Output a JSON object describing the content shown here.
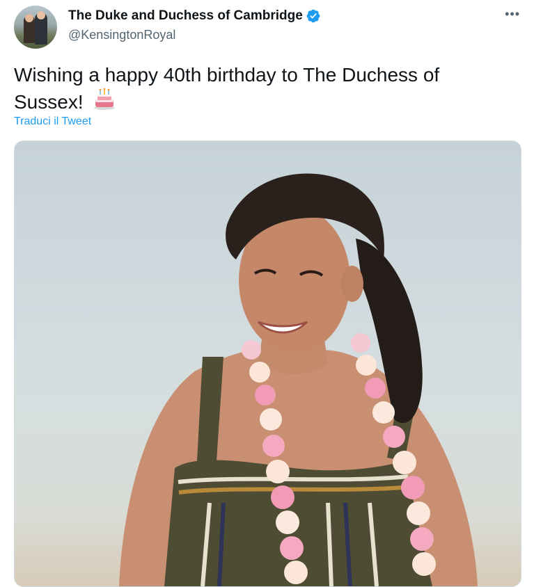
{
  "author": {
    "display_name": "The Duke and Duchess of Cambridge",
    "handle": "@KensingtonRoyal",
    "verified": true,
    "avatar_icon": "profile-photo"
  },
  "tweet": {
    "text": "Wishing a happy 40th birthday to The Duchess of Sussex!",
    "emoji": "birthday-cake",
    "translate_label": "Traduci il Tweet"
  },
  "menu": {
    "more_label": "•••"
  },
  "colors": {
    "verified_blue": "#1d9bf0",
    "link_blue": "#1d9bf0",
    "secondary_text": "#536471"
  }
}
